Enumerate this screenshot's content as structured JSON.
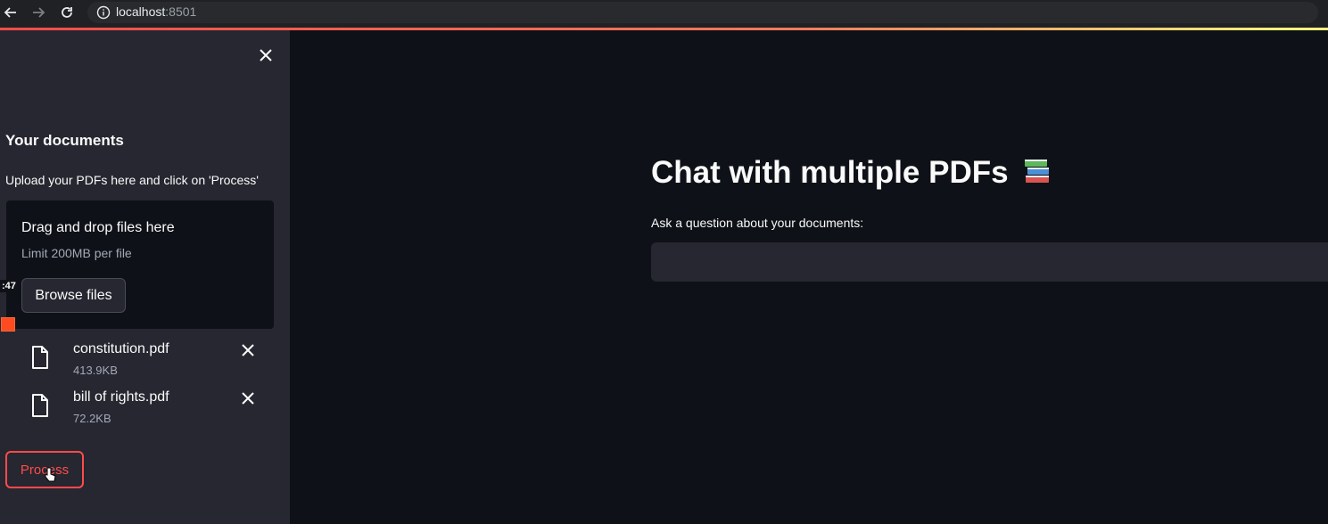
{
  "browser": {
    "url_host": "localhost",
    "url_port": ":8501"
  },
  "sidebar": {
    "heading": "Your documents",
    "upload_label": "Upload your PDFs here and click on 'Process'",
    "dropzone": {
      "title": "Drag and drop files here",
      "limit": "Limit 200MB per file",
      "browse_label": "Browse files"
    },
    "files": [
      {
        "name": "constitution.pdf",
        "size": "413.9KB"
      },
      {
        "name": "bill of rights.pdf",
        "size": "72.2KB"
      }
    ],
    "process_label": "Process"
  },
  "overlay": {
    "timer": ":47"
  },
  "main": {
    "title": "Chat with multiple PDFs",
    "title_icon": "books-icon",
    "question_label": "Ask a question about your documents:",
    "question_value": ""
  },
  "colors": {
    "accent": "#ff4b4b",
    "background": "#0e1117",
    "sidebar": "#262730"
  }
}
